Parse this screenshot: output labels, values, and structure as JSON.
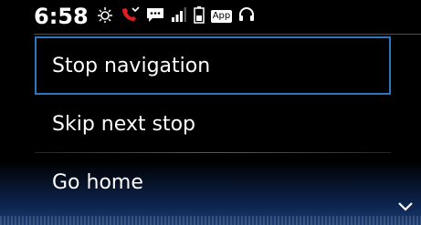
{
  "status_bar": {
    "time": "6:58",
    "icons": [
      "brightness-icon",
      "missed-call-icon",
      "message-icon",
      "signal-icon",
      "battery-icon",
      "app-badge",
      "headset-icon"
    ],
    "app_badge": "App",
    "colors": {
      "missed_call": "#e02020"
    }
  },
  "menu": {
    "items": [
      {
        "label": "Stop navigation",
        "selected": true
      },
      {
        "label": "Skip next stop",
        "selected": false
      },
      {
        "label": "Go home",
        "selected": false
      }
    ],
    "selection_color": "#2f74c0"
  },
  "scroll_indicator": "chevron-down-icon"
}
